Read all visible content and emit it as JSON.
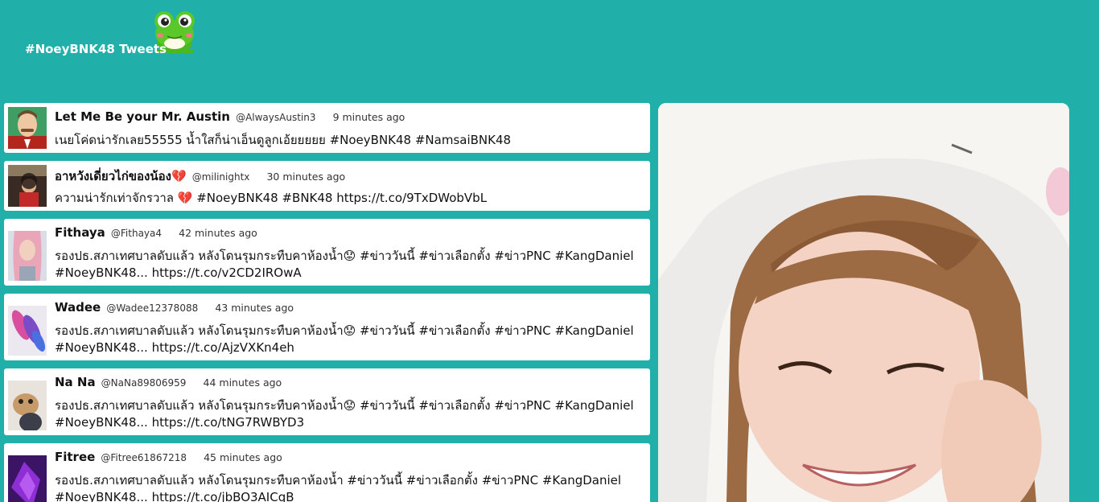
{
  "header": {
    "title": "#NoeyBNK48 Tweets"
  },
  "tweets": [
    {
      "name": "Let Me Be your Mr. Austin",
      "handle": "@AlwaysAustin3",
      "time": "9 minutes ago",
      "text": "เนยโค่ดน่ารักเลย55555 น้ำใสก็น่าเอ็นดูลูกเอ้ยยยยย #NoeyBNK48 #NamsaiBNK48"
    },
    {
      "name": "อาหวังเดี่ยวไก่ของน้อง💔",
      "handle": "@milinightx",
      "time": "30 minutes ago",
      "text": "ความน่ารักเท่าจักรวาล 💔 #NoeyBNK48 #BNK48 https://t.co/9TxDWobVbL"
    },
    {
      "name": "Fithaya",
      "handle": "@Fithaya4",
      "time": "42 minutes ago",
      "text": "รองปธ.สภาเทศบาลดับแล้ว หลังโดนรุมกระทืบคาห้องน้ำ😟 #ข่าววันนี้ #ข่าวเลือกตั้ง #ข่าวPNC #KangDaniel #NoeyBNK48... https://t.co/v2CD2IROwA"
    },
    {
      "name": "Wadee",
      "handle": "@Wadee12378088",
      "time": "43 minutes ago",
      "text": "รองปธ.สภาเทศบาลดับแล้ว หลังโดนรุมกระทืบคาห้องน้ำ😟 #ข่าววันนี้ #ข่าวเลือกตั้ง #ข่าวPNC #KangDaniel #NoeyBNK48... https://t.co/AjzVXKn4eh"
    },
    {
      "name": "Na Na",
      "handle": "@NaNa89806959",
      "time": "44 minutes ago",
      "text": "รองปธ.สภาเทศบาลดับแล้ว หลังโดนรุมกระทืบคาห้องน้ำ😟 #ข่าววันนี้ #ข่าวเลือกตั้ง #ข่าวPNC #KangDaniel #NoeyBNK48... https://t.co/tNG7RWBYD3"
    },
    {
      "name": "Fitree",
      "handle": "@Fitree61867218",
      "time": "45 minutes ago",
      "text": "รองปธ.สภาเทศบาลดับแล้ว หลังโดนรุมกระทืบคาห้องน้ำ #ข่าววันนี้ #ข่าวเลือกตั้ง #ข่าวPNC #KangDaniel #NoeyBNK48... https://t.co/jbBO3AICqB"
    }
  ],
  "colors": {
    "background": "#21b0a9",
    "card": "#ffffff",
    "frog": "#5ac828"
  }
}
